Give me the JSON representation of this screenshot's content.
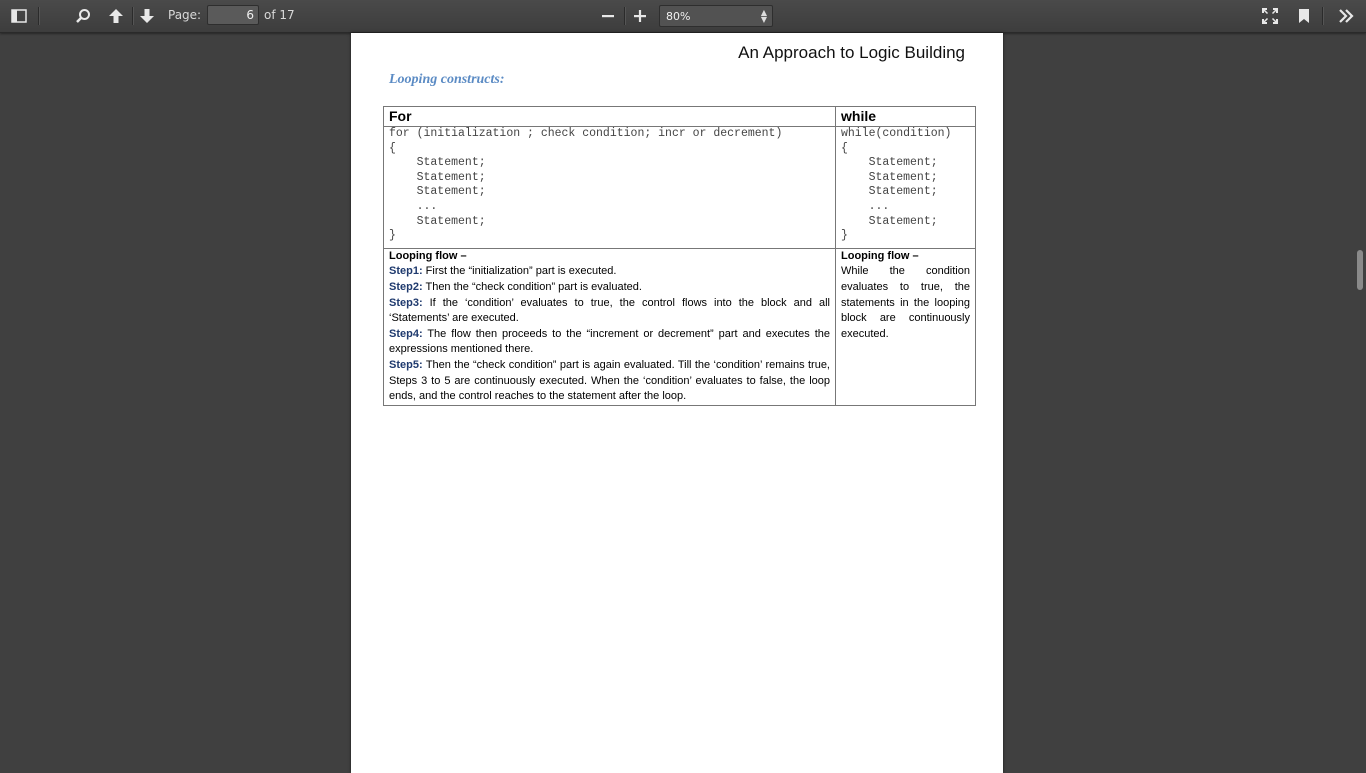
{
  "toolbar": {
    "page_label": "Page:",
    "current_page": "6",
    "page_total": "of 17",
    "zoom_value": "80%",
    "icons": [
      "sidebar-toggle-icon",
      "search-icon",
      "previous-page-icon",
      "next-page-icon",
      "zoom-out-icon",
      "zoom-in-icon",
      "presentation-mode-icon",
      "bookmark-icon",
      "tools-icon"
    ]
  },
  "document": {
    "header": "An Approach to Logic Building",
    "section_title": "Looping constructs:",
    "table": {
      "headers": [
        "For",
        "while"
      ],
      "for_code": "for (initialization ; check condition; incr or decrement)\n{\n    Statement;\n    Statement;\n    Statement;\n    ...\n    Statement;\n}",
      "while_code": "while(condition)\n{\n    Statement;\n    Statement;\n    Statement;\n    ...\n    Statement;\n}",
      "for_flow": {
        "title": "Looping flow –",
        "steps": [
          {
            "label": "Step1:",
            "text": " First the “initialization” part is executed."
          },
          {
            "label": "Step2:",
            "text": " Then the “check condition” part is evaluated."
          },
          {
            "label": "Step3:",
            "text": " If the ‘condition’ evaluates to true, the control flows into the block and all ‘Statements’ are executed."
          },
          {
            "label": "Step4:",
            "text": " The flow then proceeds to the “increment or decrement” part and executes the expressions mentioned there."
          },
          {
            "label": "Step5:",
            "text": " Then the “check condition” part is again evaluated. Till the ‘condition’ remains true, Steps 3 to 5 are continuously executed. When the ‘condition’ evaluates to false, the loop ends, and the control reaches to the statement after the loop."
          }
        ]
      },
      "while_flow": {
        "title": "Looping flow –",
        "text": "While the condition evaluates to true, the statements in the looping block are continuously executed."
      }
    }
  },
  "colors": {
    "viewer_background": "#404040",
    "toolbar": "#474747",
    "section_title": "#5b8bc4",
    "step_label": "#1f3a6e"
  }
}
